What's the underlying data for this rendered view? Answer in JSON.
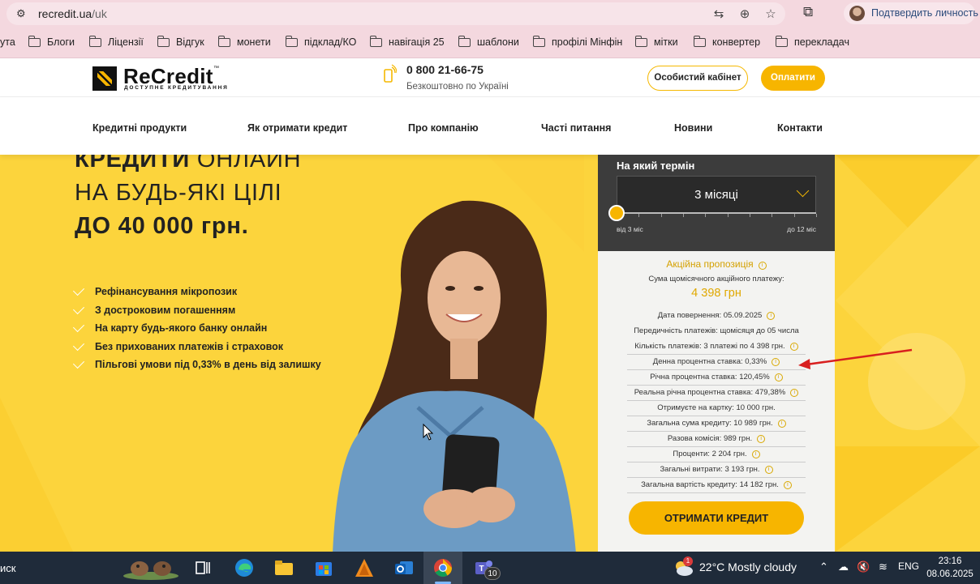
{
  "browser": {
    "url_host": "recredit.ua",
    "url_path": "/uk",
    "profile_label": "Подтвердить личность",
    "icons": [
      "site-settings-icon",
      "translate-icon",
      "zoom-icon",
      "star-icon",
      "extensions-icon"
    ]
  },
  "bookmarks": [
    {
      "label": "ута",
      "folder": false
    },
    {
      "label": "Блоги",
      "folder": true
    },
    {
      "label": "Ліцензії",
      "folder": true
    },
    {
      "label": "Відгук",
      "folder": true
    },
    {
      "label": "монети",
      "folder": true
    },
    {
      "label": "підклад/КО",
      "folder": true
    },
    {
      "label": "навігація 25",
      "folder": true
    },
    {
      "label": "шаблони",
      "folder": true
    },
    {
      "label": "профілі Мінфін",
      "folder": true
    },
    {
      "label": "мітки",
      "folder": true
    },
    {
      "label": "конвертер",
      "folder": true
    },
    {
      "label": "перекладач",
      "folder": true
    }
  ],
  "site": {
    "logo_text": "ReCredit",
    "logo_tm": "™",
    "logo_tagline": "ДОСТУПНЕ КРЕДИТУВАННЯ",
    "phone": "0 800 21-66-75",
    "phone_note": "Безкоштовно по Україні",
    "cabinet_label": "Особистий кабінет",
    "pay_label": "Оплатити",
    "accent": "#f7b500",
    "hero_bg": "#fcd43c"
  },
  "nav": [
    "Кредитні продукти",
    "Як отримати кредит",
    "Про компанію",
    "Часті питання",
    "Новини",
    "Контакти"
  ],
  "hero": {
    "line1_bold": "КРЕДИТИ",
    "line1_rest": " ОНЛАЙН",
    "line2": "НА БУДЬ-ЯКІ ЦІЛІ",
    "line3": "ДО 40 000 грн.",
    "features": [
      "Рефінансування мікропозик",
      "З достроковим погашенням",
      "На карту будь-якого банку онлайн",
      "Без прихованих платежів і страховок",
      "Пільгові умови під 0,33% в день від залишку"
    ]
  },
  "calculator": {
    "term_label": "На який термін",
    "term_value": "3 місяці",
    "term_min": "від 3 міс",
    "term_max": "до 12 міс",
    "term_slider_fraction": 0.0,
    "promo_title": "Акційна пропозиція",
    "promo_sub": "Сума щомісячного акційного платежу:",
    "promo_amount": "4 398 грн",
    "rows": [
      {
        "text": "Дата повернення: 05.09.2025",
        "info": true
      },
      {
        "text": "Передичність платежів:  щомісяця до 05 числа",
        "info": false
      },
      {
        "text": "Кількість платежів: 3 платежі  по  4 398  грн.",
        "info": true
      },
      {
        "text": "Денна процентна ставка: 0,33%",
        "info": true
      },
      {
        "text": "Річна процентна ставка: 120,45%",
        "info": true
      },
      {
        "text": "Реальна річна процентна ставка: 479,38%",
        "info": true
      },
      {
        "text": "Отримуєте на картку: 10 000  грн.",
        "info": false
      },
      {
        "text": "Загальна сума кредиту: 10 989  грн.",
        "info": true
      },
      {
        "text": "Разова комісія: 989  грн.",
        "info": true
      },
      {
        "text": "Проценти: 2 204  грн.",
        "info": true
      },
      {
        "text": "Загальні витрати: 3 193  грн.",
        "info": true
      },
      {
        "text": "Загальна вартість кредиту: 14 182  грн.",
        "info": true
      }
    ],
    "cta": "ОТРИМАТИ КРЕДИТ"
  },
  "taskbar": {
    "search_label": "иск",
    "weather_badge": "1",
    "weather": "22°C  Mostly cloudy",
    "lang": "ENG",
    "time": "23:16",
    "date": "08.06.2025",
    "teams_badge": "10"
  }
}
